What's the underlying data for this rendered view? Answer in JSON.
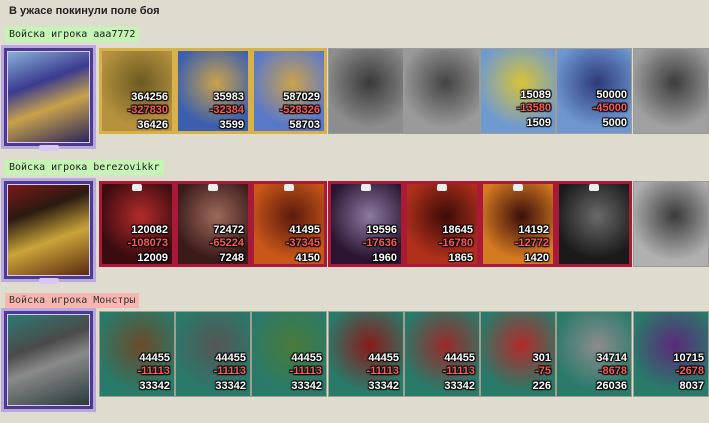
{
  "title": "В ужасе покинули поле боя",
  "players": [
    {
      "label": "Войска игрока aaa7772",
      "label_color": "#c5f5b5",
      "units": [
        {
          "n1": "364256",
          "n2": "-327830",
          "n3": "36426",
          "frame": "gold",
          "palette": [
            "#b6923e",
            "#6b5a22"
          ]
        },
        {
          "n1": "35983",
          "n2": "-32384",
          "n3": "3599",
          "frame": "gold",
          "palette": [
            "#3b5fae",
            "#c9a24a"
          ]
        },
        {
          "n1": "587029",
          "n2": "-528326",
          "n3": "58703",
          "frame": "gold",
          "palette": [
            "#5a78c8",
            "#caa24e"
          ]
        },
        {
          "n1": "",
          "n2": "",
          "n3": "",
          "frame": "gray",
          "palette": [
            "#8d8d8d",
            "#3a3a3a"
          ]
        },
        {
          "n1": "",
          "n2": "",
          "n3": "",
          "frame": "gray",
          "palette": [
            "#9a9a9a",
            "#444"
          ]
        },
        {
          "n1": "15089",
          "n2": "-13580",
          "n3": "1509",
          "frame": "plain",
          "palette": [
            "#6e9ad0",
            "#d7c33a"
          ]
        },
        {
          "n1": "50000",
          "n2": "-45000",
          "n3": "5000",
          "frame": "plain",
          "palette": [
            "#6e97d0",
            "#2e3a7a"
          ]
        },
        {
          "n1": "",
          "n2": "",
          "n3": "",
          "frame": "gray",
          "palette": [
            "#a0a0a0",
            "#3d3d3d"
          ]
        }
      ]
    },
    {
      "label": "Войска игрока berezovikkr",
      "label_color": "#c5f5b5",
      "units": [
        {
          "n1": "120082",
          "n2": "-108073",
          "n3": "12009",
          "frame": "red",
          "palette": [
            "#3a0b0f",
            "#b22c2c"
          ]
        },
        {
          "n1": "72472",
          "n2": "-65224",
          "n3": "7248",
          "frame": "red",
          "palette": [
            "#3b1a1a",
            "#9c6a5a"
          ]
        },
        {
          "n1": "41495",
          "n2": "-37345",
          "n3": "4150",
          "frame": "red",
          "palette": [
            "#c9571a",
            "#5a1b0c"
          ]
        },
        {
          "n1": "19596",
          "n2": "-17636",
          "n3": "1960",
          "frame": "red",
          "palette": [
            "#2a1430",
            "#8c7aa0"
          ]
        },
        {
          "n1": "18645",
          "n2": "-16780",
          "n3": "1865",
          "frame": "red",
          "palette": [
            "#b1301c",
            "#3b0c08"
          ]
        },
        {
          "n1": "14192",
          "n2": "-12772",
          "n3": "1420",
          "frame": "red",
          "palette": [
            "#d47a22",
            "#3a0f0a"
          ]
        },
        {
          "n1": "",
          "n2": "",
          "n3": "",
          "frame": "red",
          "palette": [
            "#1a1a1a",
            "#6a6a6a"
          ]
        },
        {
          "n1": "",
          "n2": "",
          "n3": "",
          "frame": "gray",
          "palette": [
            "#b0b0b0",
            "#3a3a3a"
          ]
        }
      ]
    },
    {
      "label": "Войска игрока Монстры",
      "label_color": "#f7b6b0",
      "units": [
        {
          "n1": "44455",
          "n2": "-11113",
          "n3": "33342",
          "frame": "plain",
          "palette": [
            "#2a7a6a",
            "#6a4a2a"
          ]
        },
        {
          "n1": "44455",
          "n2": "-11113",
          "n3": "33342",
          "frame": "plain",
          "palette": [
            "#2a7a6a",
            "#555"
          ]
        },
        {
          "n1": "44455",
          "n2": "-11113",
          "n3": "33342",
          "frame": "plain",
          "palette": [
            "#2a7a6a",
            "#4a7a3a"
          ]
        },
        {
          "n1": "44455",
          "n2": "-11113",
          "n3": "33342",
          "frame": "plain",
          "palette": [
            "#2a7a6a",
            "#8a1a1a"
          ]
        },
        {
          "n1": "44455",
          "n2": "-11113",
          "n3": "33342",
          "frame": "plain",
          "palette": [
            "#2a7a6a",
            "#9a2a2a"
          ]
        },
        {
          "n1": "301",
          "n2": "-75",
          "n3": "226",
          "frame": "plain",
          "palette": [
            "#2a7a6a",
            "#b42a2a"
          ]
        },
        {
          "n1": "34714",
          "n2": "-8678",
          "n3": "26036",
          "frame": "plain",
          "palette": [
            "#2a7a6a",
            "#8c8c8c"
          ]
        },
        {
          "n1": "10715",
          "n2": "-2678",
          "n3": "8037",
          "frame": "plain",
          "palette": [
            "#2a7a6a",
            "#5a2a7a"
          ]
        }
      ]
    }
  ],
  "colors": {
    "background": "#dedbcf",
    "hero_frame": "#b9a7df",
    "hero_bg": "#4a3b8f",
    "damage": "#ff5a5a"
  },
  "icons": [
    "hero-portrait",
    "creature-stack-icon",
    "skull-icon"
  ]
}
